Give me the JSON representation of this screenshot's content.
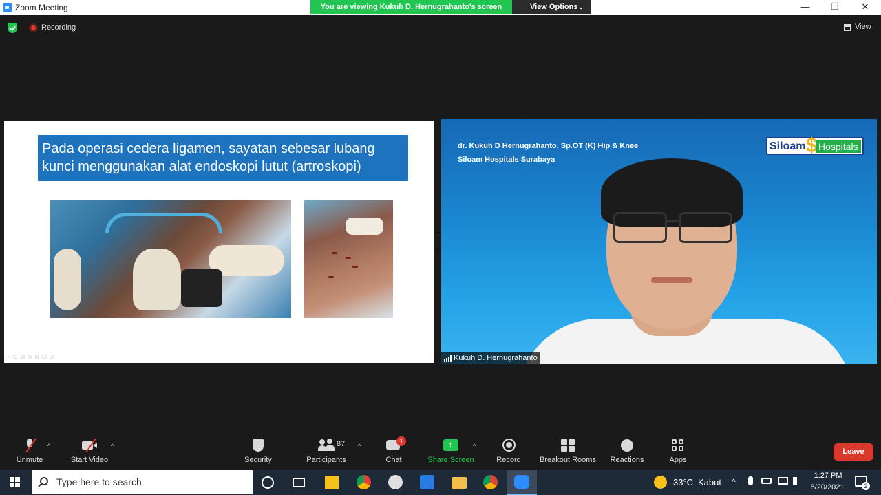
{
  "window": {
    "title": "Zoom Meeting",
    "minimize_glyph": "—",
    "restore_glyph": "❐",
    "close_glyph": "✕"
  },
  "share_banner": {
    "text": "You are viewing Kukuh D. Hernugrahanto's screen",
    "view_options": "View Options",
    "chevron": "⌄"
  },
  "meeting_header": {
    "recording_label": "Recording",
    "view_label": "View"
  },
  "slide": {
    "title": "Pada operasi cedera ligamen, sayatan sebesar lubang kunci menggunakan alat endoskopi lutut (artroskopi)",
    "controls": "○⊙⊘⊕⊛⊟⊝"
  },
  "video": {
    "lower_third_line1": "dr. Kukuh D Hernugrahanto, Sp.OT (K) Hip & Knee",
    "lower_third_line2": "Siloam Hospitals Surabaya",
    "logo_siloam": "Siloam",
    "logo_hospitals": "Hospitals",
    "logo_glyph": "$",
    "participant_name": "Kukuh D. Hernugrahanto"
  },
  "toolbar": {
    "unmute": "Unmute",
    "start_video": "Start Video",
    "security": "Security",
    "participants": "Participants",
    "participants_count": "87",
    "chat": "Chat",
    "chat_badge": "1",
    "share_screen": "Share Screen",
    "share_arrow": "↑",
    "record": "Record",
    "breakout_rooms": "Breakout Rooms",
    "reactions": "Reactions",
    "apps": "Apps",
    "leave": "Leave",
    "caret": "^"
  },
  "taskbar": {
    "search_placeholder": "Type here to search",
    "weather_temp": "33°C",
    "weather_text": "Kabut",
    "tray_caret": "^",
    "time": "1:27 PM",
    "date": "8/20/2021",
    "notifications_count": "2"
  },
  "colors": {
    "zoom_blue": "#2d8cff",
    "share_green": "#23c552",
    "leave_red": "#d9382c",
    "slide_title_blue": "#1e73be"
  }
}
